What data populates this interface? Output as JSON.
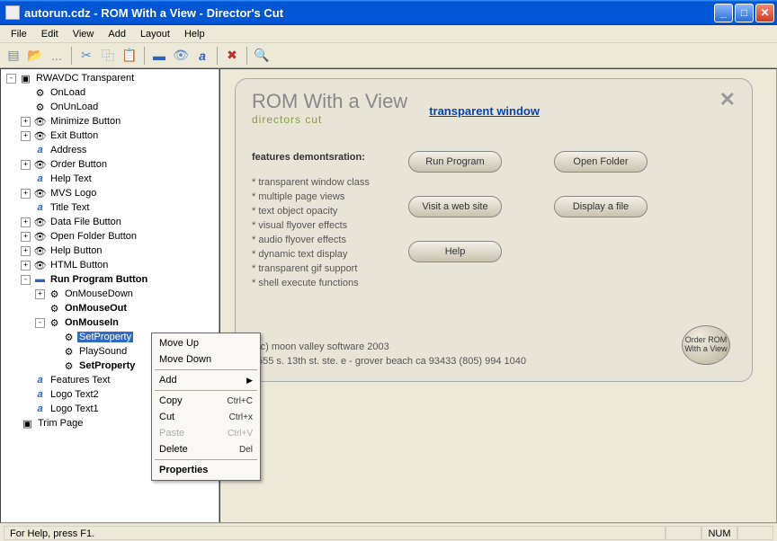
{
  "title": "autorun.cdz - ROM With a View - Director's Cut",
  "menu": {
    "file": "File",
    "edit": "Edit",
    "view": "View",
    "add": "Add",
    "layout": "Layout",
    "help": "Help"
  },
  "tree": {
    "root": "RWAVDC Transparent",
    "items": [
      "OnLoad",
      "OnUnLoad",
      "Minimize Button",
      "Exit Button",
      "Address",
      "Order Button",
      "Help Text",
      "MVS Logo",
      "Title Text",
      "Data File Button",
      "Open Folder Button",
      "Help Button",
      "HTML Button",
      "Run Program Button",
      "OnMouseDown",
      "OnMouseOut",
      "OnMouseIn",
      "SetProperty",
      "PlaySound",
      "SetProperty",
      "Features Text",
      "Logo Text2",
      "Logo Text1",
      "Trim Page"
    ]
  },
  "ctx": {
    "moveUp": "Move Up",
    "moveDown": "Move Down",
    "add": "Add",
    "copy": "Copy",
    "cut": "Cut",
    "paste": "Paste",
    "delete": "Delete",
    "properties": "Properties",
    "scCopy": "Ctrl+C",
    "scCut": "Ctrl+x",
    "scPaste": "Ctrl+V",
    "scDelete": "Del"
  },
  "preview": {
    "title": "ROM With a View",
    "sub": "directors cut",
    "link": "transparent window",
    "featuresHeader": "features demontsration:",
    "features": [
      "* transparent window class",
      "* multiple page views",
      "* text object opacity",
      "* visual flyover effects",
      "* audio flyover effects",
      "* dynamic text display",
      "* transparent gif support",
      "* shell execute functions"
    ],
    "buttons": {
      "run": "Run Program",
      "open": "Open Folder",
      "visit": "Visit a web site",
      "display": "Display a  file",
      "help": "Help"
    },
    "orderBtn": "Order ROM With a View",
    "copyright": "(c) moon valley software 2003",
    "address": "555 s. 13th st. ste. e - grover beach ca 93433 (805) 994 1040"
  },
  "status": {
    "help": "For Help, press F1.",
    "num": "NUM"
  }
}
